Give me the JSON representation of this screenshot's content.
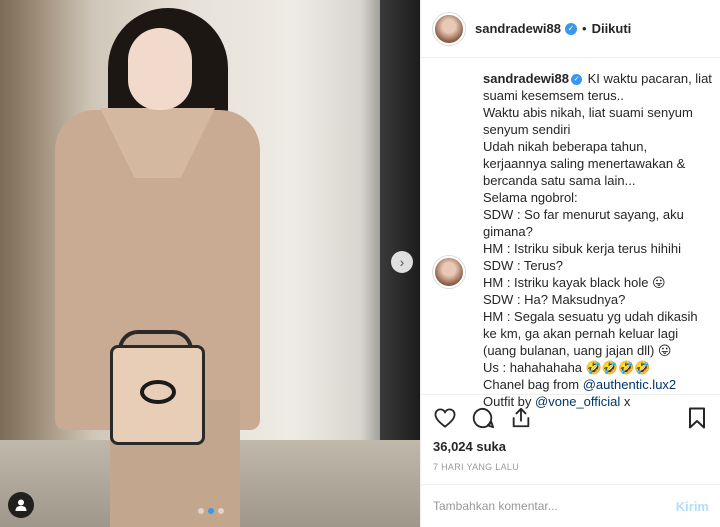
{
  "post": {
    "username": "sandradewi88",
    "follow_status": "Diikuti",
    "bullet": "•",
    "photo_count": 3,
    "active_photo": 2,
    "next_arrow_glyph": "›"
  },
  "caption": {
    "username": "sandradewi88",
    "lines": [
      "KI waktu pacaran, liat",
      "suami kesemsem terus..",
      "Waktu abis nikah, liat suami senyum",
      "senyum sendiri",
      "Udah nikah beberapa tahun,",
      "kerjaannya saling menertawakan &",
      "bercanda satu sama lain...",
      "Selama ngobrol:",
      "SDW : So far menurut sayang, aku",
      "gimana?",
      "HM : Istriku sibuk kerja terus hihihi",
      "SDW : Terus?",
      "HM : Istriku kayak black hole 😛",
      "SDW : Ha? Maksudnya?",
      "HM : Segala sesuatu yg udah dikasih",
      "ke km, ga akan pernah keluar lagi",
      "(uang bulanan, uang jajan dll) 😛",
      "Us : hahahahaha 🤣🤣🤣🤣"
    ],
    "bag_prefix": "Chanel bag from ",
    "bag_link": "@authentic.lux2",
    "outfit_prefix": "Outfit by ",
    "outfit_link": "@vone_official",
    "outfit_suffix": " x"
  },
  "actions": {
    "likes": "36,024 suka",
    "time": "7 HARI YANG LALU"
  },
  "comment_box": {
    "placeholder": "Tambahkan komentar...",
    "post_label": "Kirim"
  },
  "colors": {
    "verified": "#3897f0",
    "link": "#003569",
    "post_disabled": "#b2dffc"
  }
}
